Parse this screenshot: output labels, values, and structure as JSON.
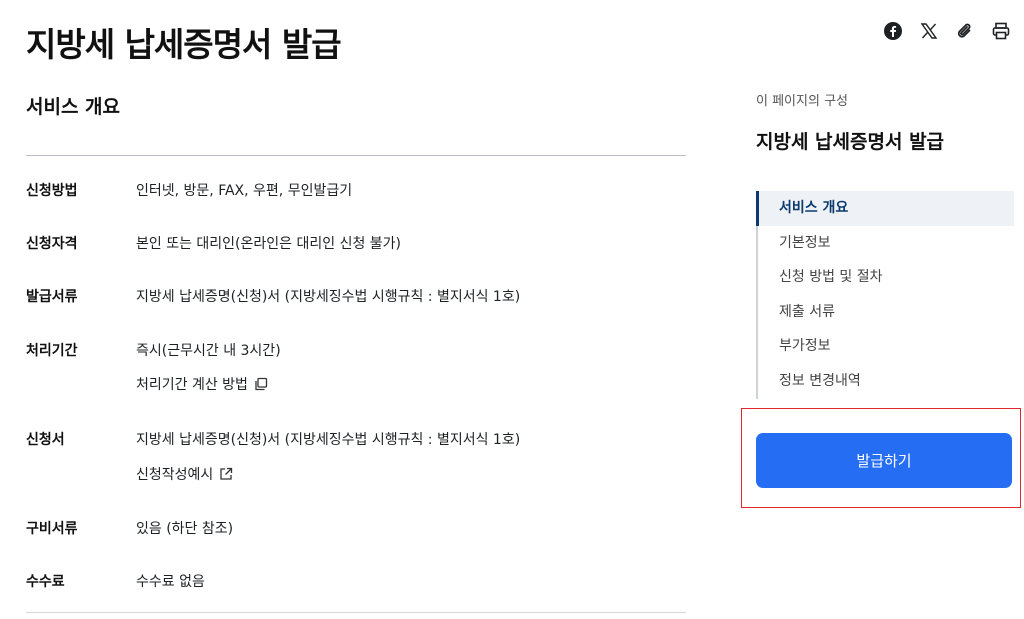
{
  "page": {
    "title": "지방세 납세증명서 발급"
  },
  "share": {
    "icons": [
      "facebook-icon",
      "x-icon",
      "link-icon",
      "print-icon"
    ]
  },
  "overview": {
    "section_title": "서비스 개요",
    "rows": [
      {
        "label": "신청방법",
        "value": "인터넷, 방문, FAX, 우편, 무인발급기"
      },
      {
        "label": "신청자격",
        "value": "본인 또는 대리인(온라인은 대리인 신청 불가)"
      },
      {
        "label": "발급서류",
        "value": "지방세 납세증명(신청)서 (지방세징수법 시행규칙 : 별지서식 1호)"
      },
      {
        "label": "처리기간",
        "value": "즉시(근무시간 내 3시간)",
        "link": "처리기간 계산 방법"
      },
      {
        "label": "신청서",
        "value": "지방세 납세증명(신청)서 (지방세징수법 시행규칙 : 별지서식 1호)",
        "link": "신청작성예시"
      },
      {
        "label": "구비서류",
        "value": "있음 (하단 참조)"
      },
      {
        "label": "수수료",
        "value": "수수료 없음"
      }
    ]
  },
  "toc": {
    "caption": "이 페이지의 구성",
    "title": "지방세 납세증명서 발급",
    "items": [
      "서비스 개요",
      "기본정보",
      "신청 방법 및 절차",
      "제출 서류",
      "부가정보",
      "정보 변경내역"
    ],
    "active_index": 0
  },
  "action": {
    "issue_label": "발급하기",
    "button_color": "#256ef4",
    "highlight_color": "#e3262b"
  }
}
